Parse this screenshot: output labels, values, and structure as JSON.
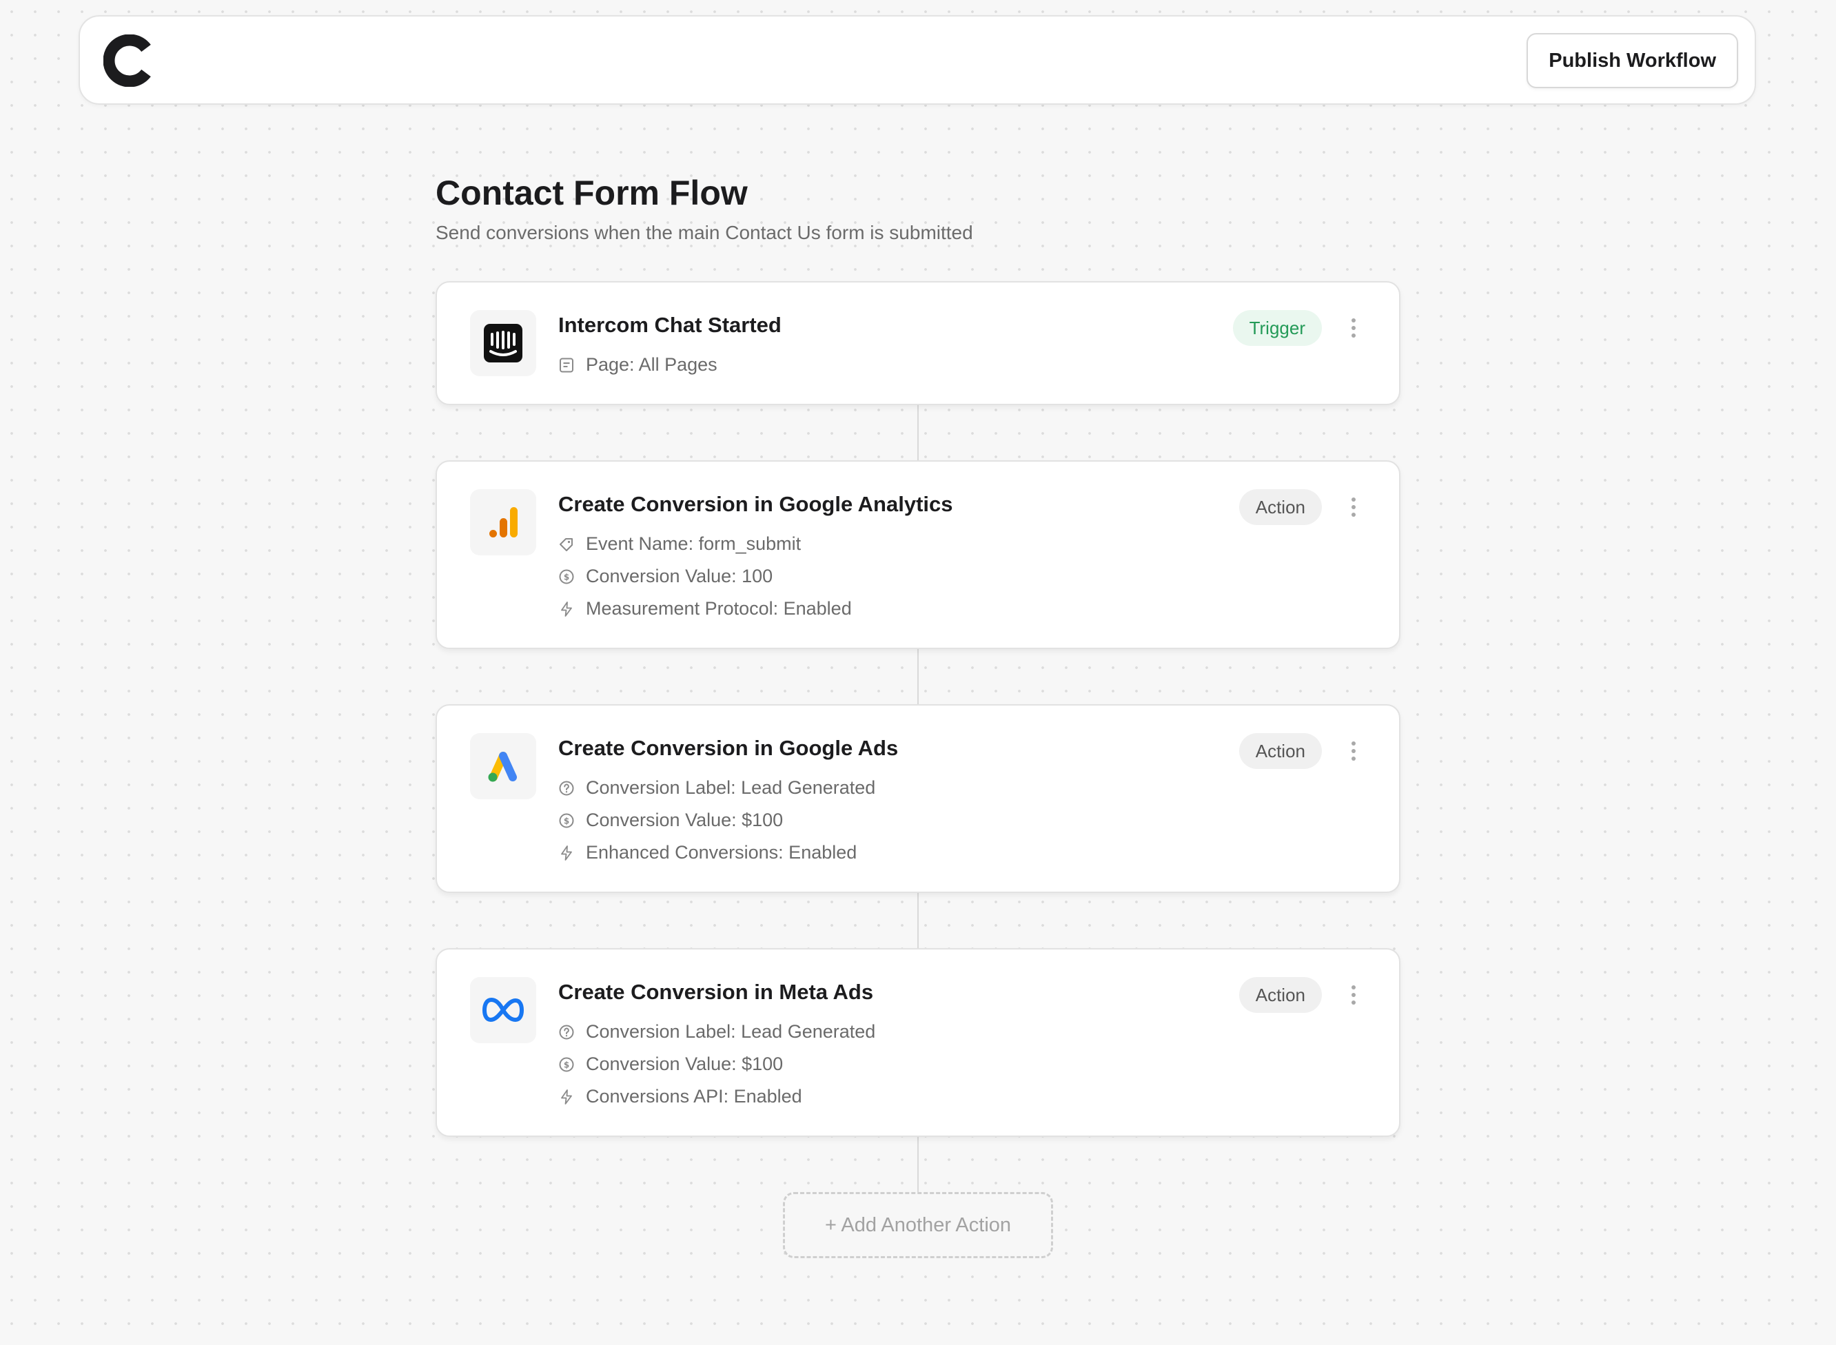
{
  "toolbar": {
    "logo_name": "brand-c-logo",
    "publish_label": "Publish Workflow"
  },
  "workflow": {
    "title": "Contact Form Flow",
    "subtitle": "Send conversions when the main Contact Us form is submitted"
  },
  "steps": [
    {
      "title": "Intercom Chat Started",
      "badge": "Trigger",
      "icon": "intercom-icon",
      "details": [
        {
          "icon": "page-icon",
          "text": "Page: All Pages"
        }
      ]
    },
    {
      "title": "Create Conversion in Google Analytics",
      "badge": "Action",
      "icon": "google-analytics-icon",
      "details": [
        {
          "icon": "tag-icon",
          "text": "Event Name: form_submit"
        },
        {
          "icon": "dollar-circle-icon",
          "text": "Conversion Value: 100"
        },
        {
          "icon": "bolt-icon",
          "text": "Measurement Protocol: Enabled"
        }
      ]
    },
    {
      "title": "Create Conversion in Google Ads",
      "badge": "Action",
      "icon": "google-ads-icon",
      "details": [
        {
          "icon": "help-circle-icon",
          "text": "Conversion Label: Lead Generated"
        },
        {
          "icon": "dollar-circle-icon",
          "text": "Conversion Value: $100"
        },
        {
          "icon": "bolt-icon",
          "text": "Enhanced Conversions: Enabled"
        }
      ]
    },
    {
      "title": "Create Conversion in Meta Ads",
      "badge": "Action",
      "icon": "meta-icon",
      "details": [
        {
          "icon": "help-circle-icon",
          "text": "Conversion Label: Lead Generated"
        },
        {
          "icon": "dollar-circle-icon",
          "text": "Conversion Value: $100"
        },
        {
          "icon": "bolt-icon",
          "text": "Conversions API: Enabled"
        }
      ]
    }
  ],
  "add_action": {
    "label": "+ Add Another Action"
  },
  "colors": {
    "trigger_badge_text": "#239a57",
    "trigger_badge_bg": "#eaf7ef",
    "action_badge_bg": "#f0f0f0",
    "ga_orange": "#f9ab00",
    "ga_dark_orange": "#e37400",
    "ads_blue": "#4285f4",
    "ads_yellow": "#fbbc04",
    "ads_green": "#34a853",
    "meta_blue": "#1877f2"
  }
}
